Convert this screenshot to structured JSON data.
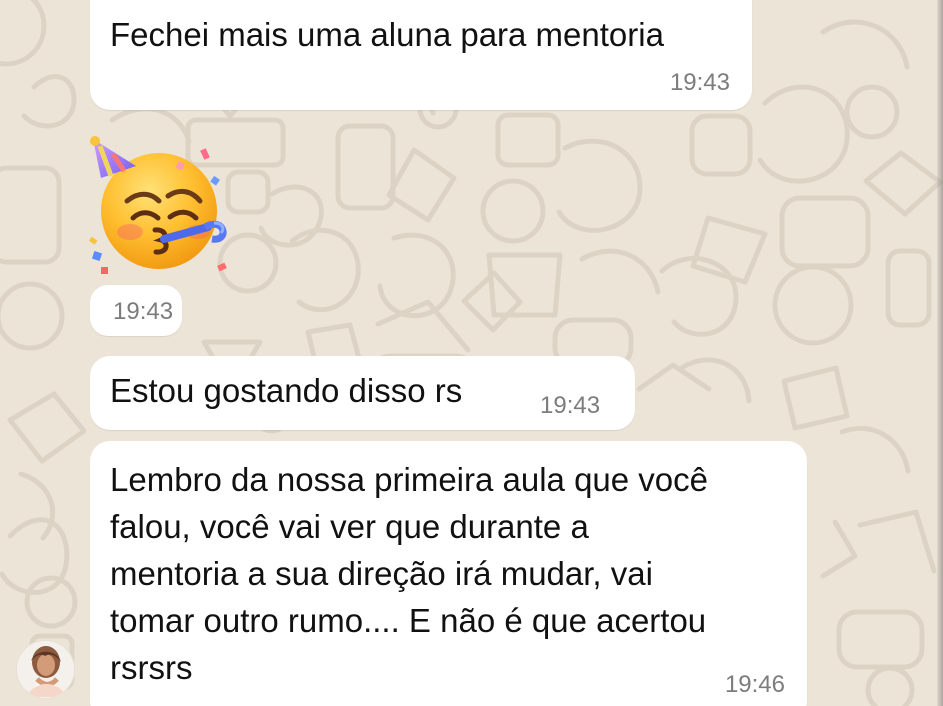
{
  "chat": {
    "messages": [
      {
        "text": "Fechei mais uma aluna para mentoria",
        "time": "19:43"
      },
      {
        "type": "sticker",
        "emoji": "partying-face-icon",
        "time": "19:43"
      },
      {
        "text": "Estou gostando disso rs",
        "time": "19:43"
      },
      {
        "text": "Lembro da nossa primeira aula que você\nfalou, você vai ver que durante a\nmentoria a sua direção irá mudar, vai\ntomar outro rumo.... E não é que acertou\nrsrsrs",
        "time": "19:46"
      }
    ]
  },
  "colors": {
    "background": "#ede4d8",
    "bubble": "#ffffff",
    "timestamp": "#7c7c7c"
  }
}
